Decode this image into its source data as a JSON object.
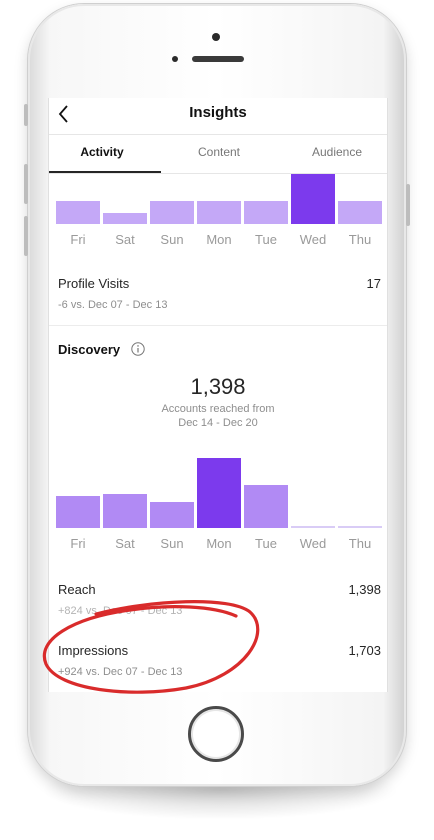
{
  "header": {
    "title": "Insights"
  },
  "tabs": [
    {
      "label": "Activity",
      "active": true
    },
    {
      "label": "Content",
      "active": false
    },
    {
      "label": "Audience",
      "active": false
    }
  ],
  "activity_chart": {
    "type": "bar",
    "categories": [
      "Fri",
      "Sat",
      "Sun",
      "Mon",
      "Tue",
      "Wed",
      "Thu"
    ],
    "values": [
      23,
      11,
      23,
      23,
      23,
      51,
      23
    ],
    "highlight_index": 5,
    "colors": {
      "bar": "#c4a8f7",
      "highlight": "#7c3aed"
    }
  },
  "profile_visits": {
    "label": "Profile Visits",
    "value": "17",
    "comparison": "-6 vs. Dec 07 - Dec 13"
  },
  "discovery": {
    "title": "Discovery",
    "accounts_reached": "1,398",
    "caption_line1": "Accounts reached from",
    "caption_line2": "Dec 14 - Dec 20"
  },
  "chart_data": {
    "type": "bar",
    "categories": [
      "Fri",
      "Sat",
      "Sun",
      "Mon",
      "Tue",
      "Wed",
      "Thu"
    ],
    "values": [
      32,
      34,
      26,
      69,
      42,
      1,
      1
    ],
    "highlight_index": 3,
    "colors": {
      "bar": "#b18af4",
      "highlight": "#7c3aed",
      "empty": "#d9ccf6"
    }
  },
  "reach": {
    "label": "Reach",
    "value": "1,398",
    "comparison": "+824 vs. Dec 07 - Dec 13"
  },
  "impressions": {
    "label": "Impressions",
    "value": "1,703",
    "comparison": "+924 vs. Dec 07 - Dec 13"
  },
  "annotation_color": "#d92b2b"
}
